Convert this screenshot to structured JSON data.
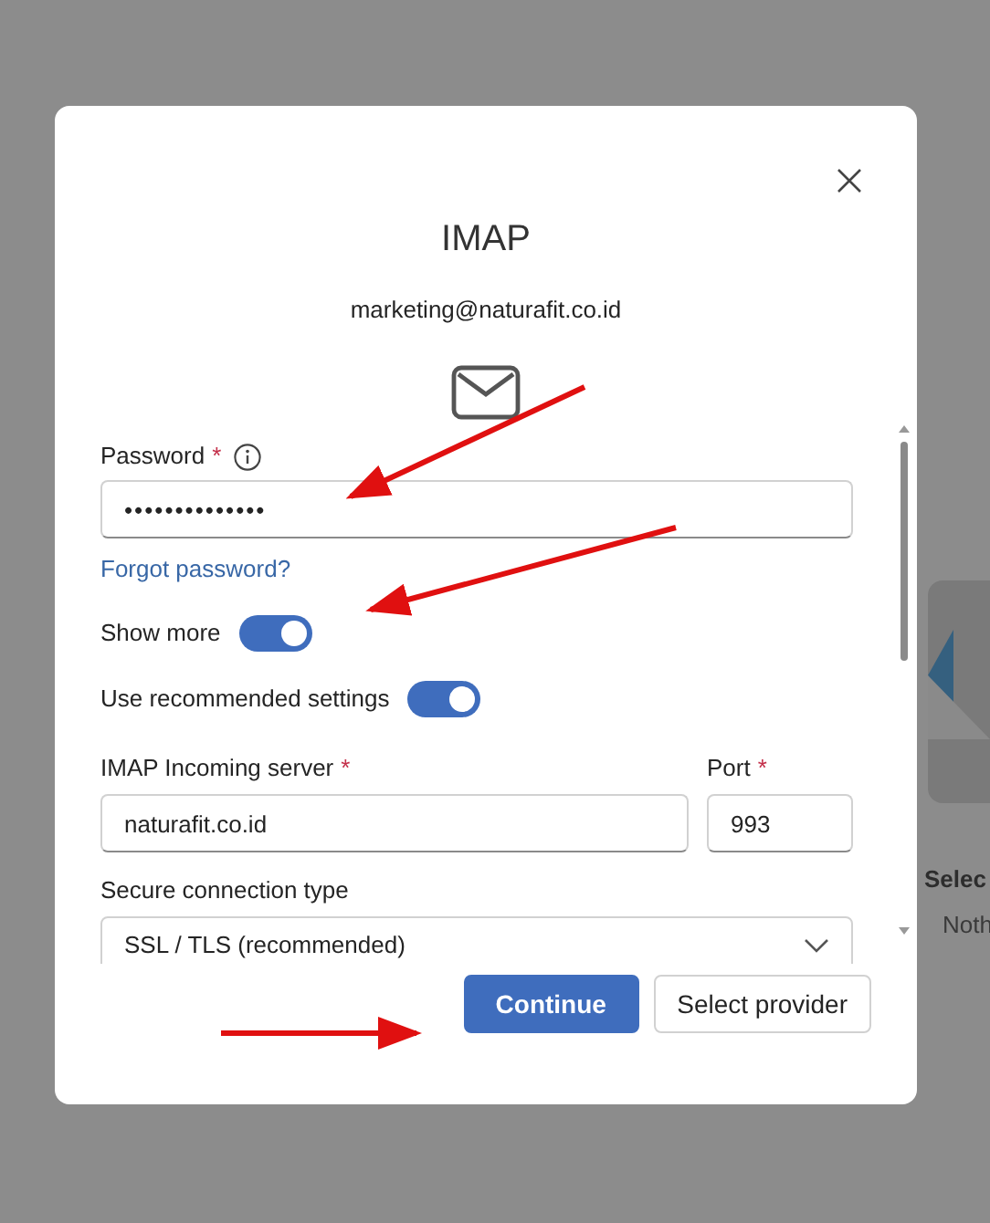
{
  "background": {
    "card_title": "Selec",
    "card_text": "Noth"
  },
  "dialog": {
    "title": "IMAP",
    "email": "marketing@naturafit.co.id",
    "password": {
      "label": "Password",
      "required_mark": "*",
      "value": "••••••••••••••"
    },
    "forgot_link": "Forgot password?",
    "toggles": [
      {
        "label": "Show more",
        "on": true
      },
      {
        "label": "Use recommended settings",
        "on": true
      }
    ],
    "server": {
      "label": "IMAP Incoming server",
      "required_mark": "*",
      "value": "naturafit.co.id"
    },
    "port": {
      "label": "Port",
      "required_mark": "*",
      "value": "993"
    },
    "connection": {
      "label": "Secure connection type",
      "value": "SSL / TLS (recommended)"
    },
    "buttons": [
      {
        "label": "Continue",
        "kind": "primary"
      },
      {
        "label": "Select provider",
        "kind": "secondary"
      }
    ]
  }
}
